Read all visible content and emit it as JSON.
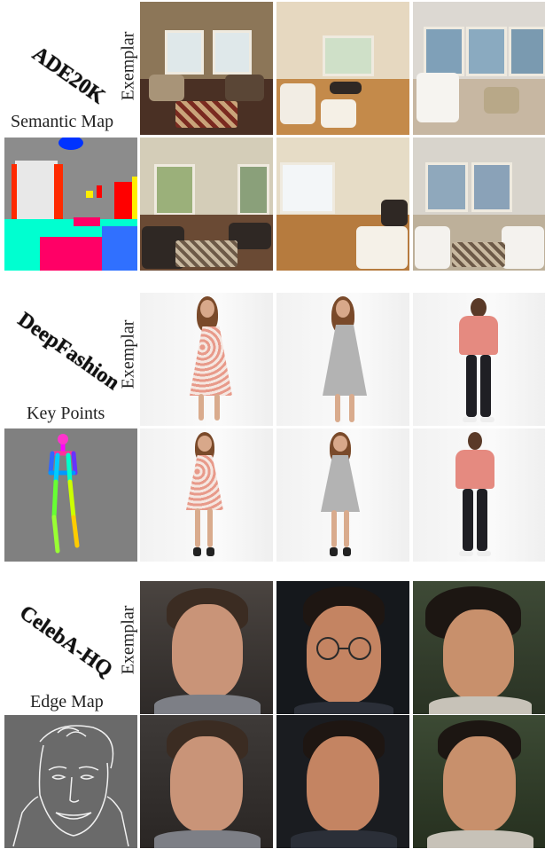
{
  "panels": [
    {
      "dataset": "ADE20K",
      "exemplar_label": "Exemplar",
      "condition_label": "Semantic Map"
    },
    {
      "dataset": "DeepFashion",
      "exemplar_label": "Exemplar",
      "condition_label": "Key Points"
    },
    {
      "dataset": "CelebA-HQ",
      "exemplar_label": "Exemplar",
      "condition_label": "Edge Map"
    }
  ]
}
